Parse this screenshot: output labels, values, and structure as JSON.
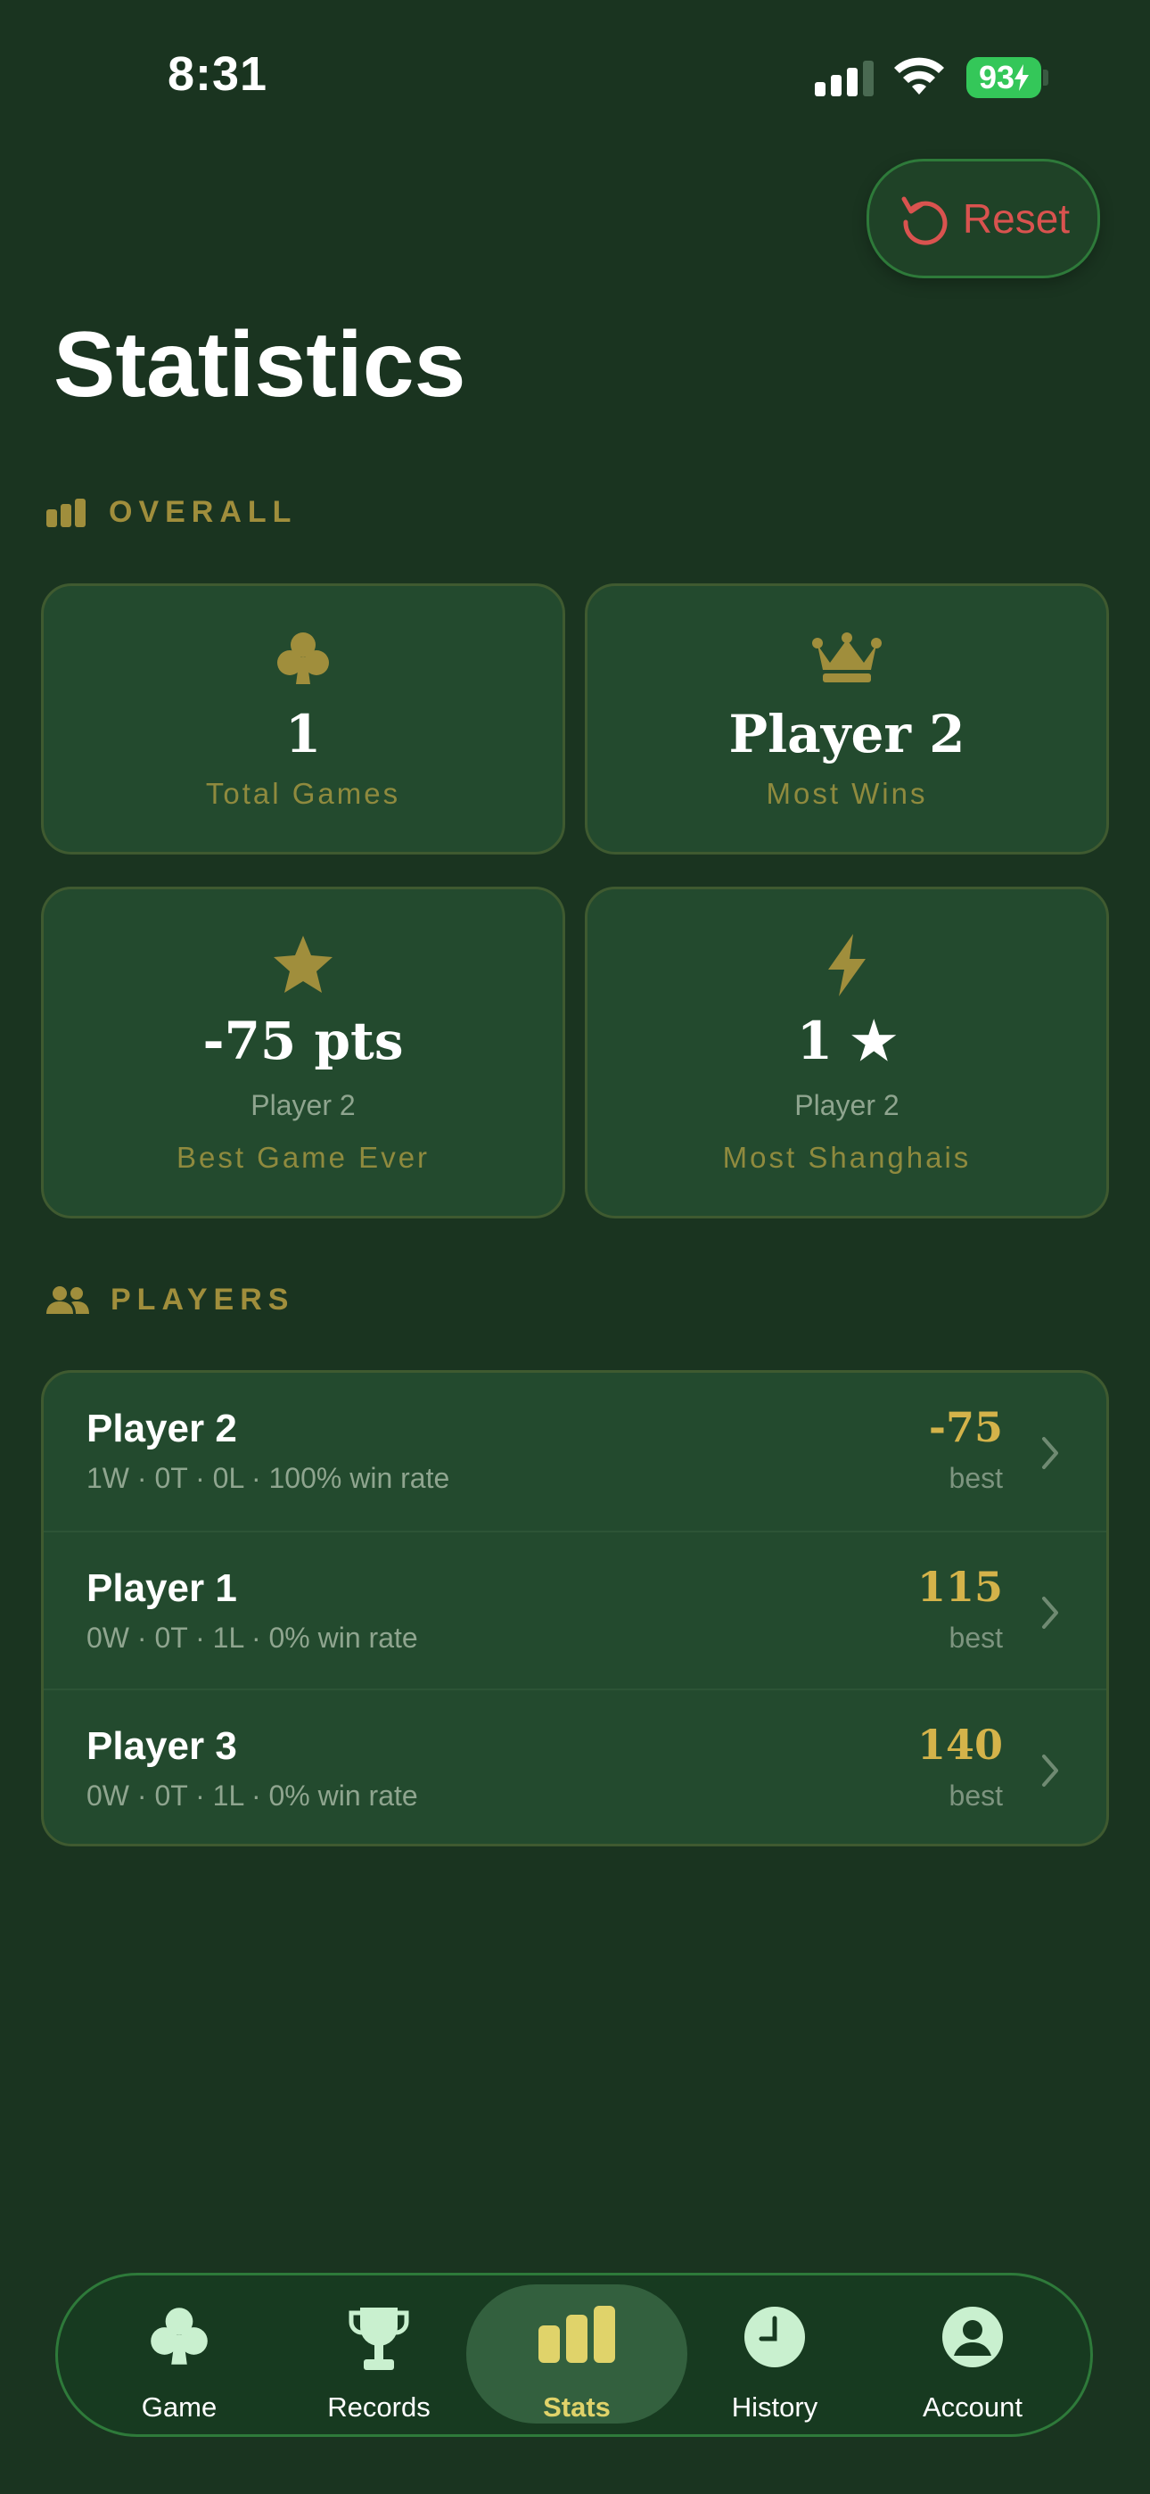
{
  "status_bar": {
    "time": "8:31",
    "battery": "93"
  },
  "header": {
    "reset_label": "Reset",
    "title": "Statistics"
  },
  "overall": {
    "heading": "OVERALL",
    "cards": [
      {
        "icon": "club-icon",
        "value": "1",
        "sub": "",
        "label": "Total Games"
      },
      {
        "icon": "crown-icon",
        "value": "Player 2",
        "sub": "",
        "label": "Most Wins"
      },
      {
        "icon": "star-icon",
        "value": "-75 pts",
        "sub": "Player 2",
        "label": "Best Game Ever"
      },
      {
        "icon": "bolt-icon",
        "value": "1 ★",
        "sub": "Player 2",
        "label": "Most Shanghais"
      }
    ]
  },
  "players": {
    "heading": "PLAYERS",
    "rows": [
      {
        "name": "Player 2",
        "meta": "1W · 0T · 0L · 100% win rate",
        "score": "-75",
        "best_label": "best"
      },
      {
        "name": "Player 1",
        "meta": "0W · 0T · 1L · 0% win rate",
        "score": "115",
        "best_label": "best"
      },
      {
        "name": "Player 3",
        "meta": "0W · 0T · 1L · 0% win rate",
        "score": "140",
        "best_label": "best"
      }
    ]
  },
  "tabbar": {
    "active": "Stats",
    "tabs": [
      {
        "label": "Game",
        "icon": "club-icon"
      },
      {
        "label": "Records",
        "icon": "trophy-icon"
      },
      {
        "label": "Stats",
        "icon": "bar-chart-icon"
      },
      {
        "label": "History",
        "icon": "clock-icon"
      },
      {
        "label": "Account",
        "icon": "person-icon"
      }
    ]
  },
  "colors": {
    "background": "#1a3420",
    "accent_gold": "#d4b34a",
    "reset_red": "#d9534f",
    "tab_active": "#e0d36a"
  }
}
